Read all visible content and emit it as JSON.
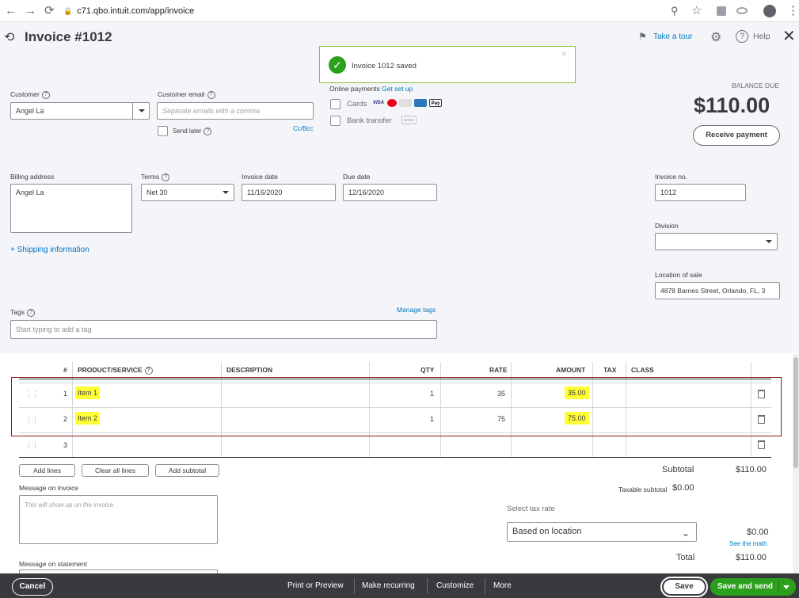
{
  "browser": {
    "url": "c71.qbo.intuit.com/app/invoice",
    "back_icon": "←",
    "forward_icon": "→",
    "reload_icon": "⟳",
    "lock_icon": "🔒",
    "zoom_icon": "⊕",
    "star_icon": "☆",
    "menu_icon": "⋮"
  },
  "header": {
    "title": "Invoice #1012",
    "take_tour": "Take a tour",
    "help": "Help"
  },
  "toast": {
    "message": "Invoice 1012 saved",
    "close": "×"
  },
  "customer": {
    "label": "Customer",
    "value": "Angel La"
  },
  "customer_email": {
    "label": "Customer email",
    "placeholder": "Separate emails with a comma",
    "send_later": "Send later",
    "cc_bcc": "Cc/Bcc"
  },
  "online_payments": {
    "label": "Online payments",
    "get_set_up": "Get set up",
    "cards": "Cards",
    "bank_transfer": "Bank transfer",
    "card_brands": [
      "VISA",
      "MC",
      "DISC",
      "AMEX",
      "Pay"
    ],
    "bank_badge": "BANK"
  },
  "balance": {
    "label": "BALANCE DUE",
    "amount": "$110.00",
    "receive_payment": "Receive payment"
  },
  "billing": {
    "label": "Billing address",
    "value": "Angel La",
    "shipping_link": "+ Shipping information"
  },
  "terms": {
    "label": "Terms",
    "value": "Net 30"
  },
  "invoice_date": {
    "label": "Invoice date",
    "value": "11/16/2020"
  },
  "due_date": {
    "label": "Due date",
    "value": "12/16/2020"
  },
  "invoice_no": {
    "label": "Invoice no.",
    "value": "1012"
  },
  "division": {
    "label": "Division",
    "value": ""
  },
  "location": {
    "label": "Location of sale",
    "value": "4878  Barnes Street, Orlando, FL, 3"
  },
  "tags": {
    "label": "Tags",
    "manage": "Manage tags",
    "placeholder": "Start typing to add a tag"
  },
  "table": {
    "headers": {
      "num": "#",
      "product": "PRODUCT/SERVICE",
      "description": "DESCRIPTION",
      "qty": "QTY",
      "rate": "RATE",
      "amount": "AMOUNT",
      "tax": "TAX",
      "class": "CLASS"
    },
    "rows": [
      {
        "num": "1",
        "product": "Item 1",
        "description": "",
        "qty": "1",
        "rate": "35",
        "amount": "35.00"
      },
      {
        "num": "2",
        "product": "Item 2",
        "description": "",
        "qty": "1",
        "rate": "75",
        "amount": "75.00"
      },
      {
        "num": "3",
        "product": "",
        "description": "",
        "qty": "",
        "rate": "",
        "amount": ""
      }
    ]
  },
  "line_buttons": {
    "add_lines": "Add lines",
    "clear_all": "Clear all lines",
    "add_subtotal": "Add subtotal"
  },
  "message_invoice": {
    "label": "Message on invoice",
    "placeholder": "This will show up on the invoice."
  },
  "message_statement": {
    "label": "Message on statement"
  },
  "totals": {
    "subtotal_label": "Subtotal",
    "subtotal_value": "$110.00",
    "taxable_label": "Taxable subtotal",
    "taxable_value": "$0.00",
    "tax_rate_label": "Select tax rate",
    "tax_rate_value": "Based on location",
    "tax_value": "$0.00",
    "see_math": "See the math",
    "total_label": "Total",
    "total_value": "$110.00"
  },
  "footer": {
    "cancel": "Cancel",
    "print_preview": "Print or Preview",
    "make_recurring": "Make recurring",
    "customize": "Customize",
    "more": "More",
    "save": "Save",
    "save_send": "Save and send"
  },
  "colors": {
    "accent": "#2ca01c",
    "link": "#0077c5",
    "footer": "#393a3d",
    "highlight": "#ffff33",
    "annotation": "#8b1a1a"
  }
}
